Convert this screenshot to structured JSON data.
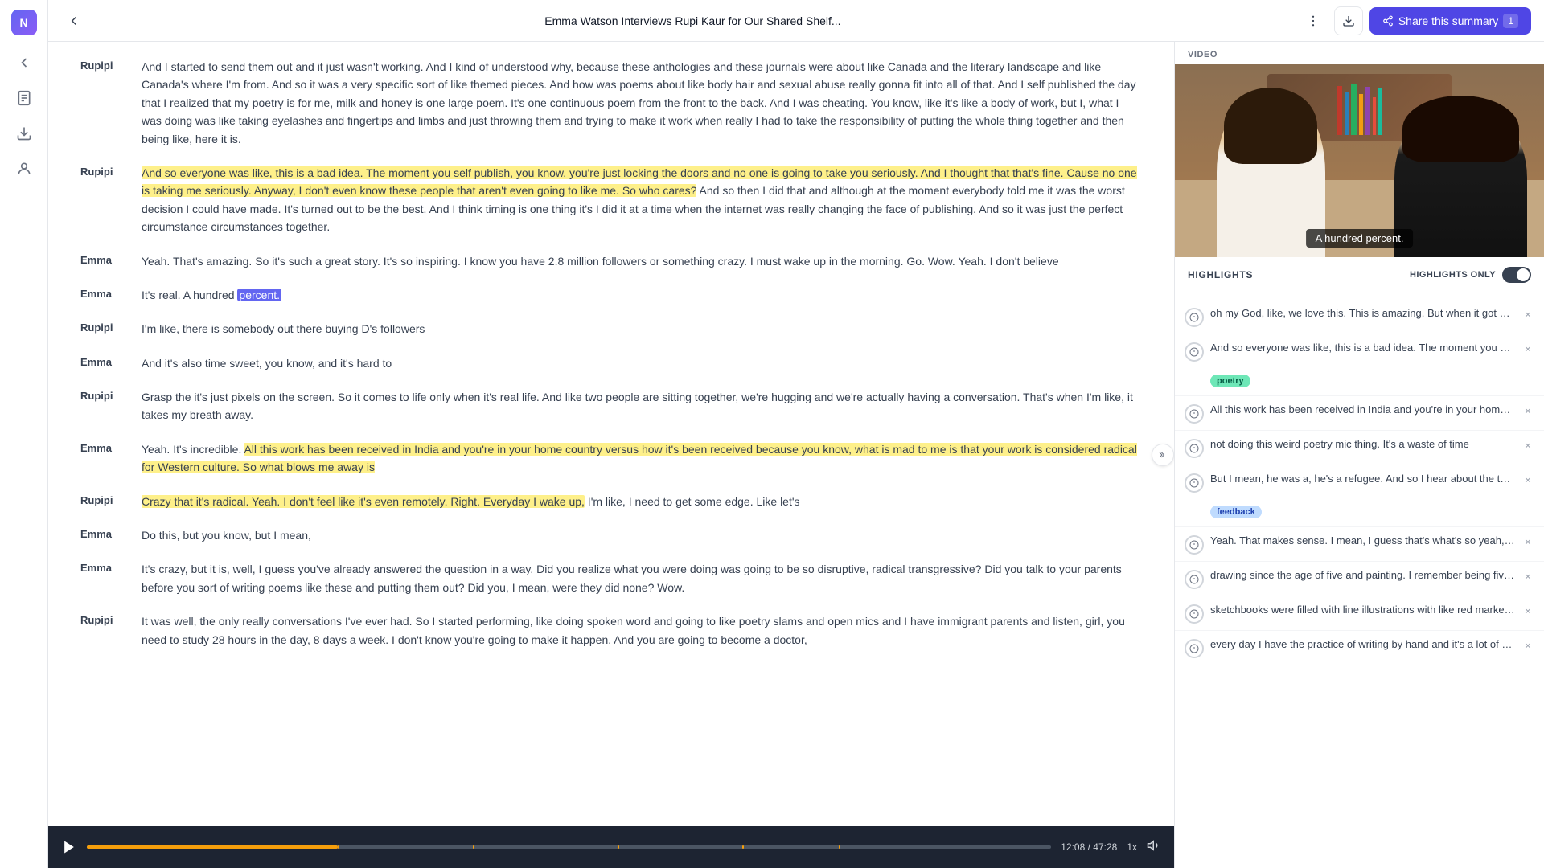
{
  "app": {
    "logo_text": "N",
    "title": "Emma Watson Interviews Rupi Kaur for Our Shared Shelf...",
    "share_button_label": "Share this summary",
    "share_count": "1"
  },
  "sidebar": {
    "icons": [
      "back",
      "document",
      "download",
      "user"
    ]
  },
  "video": {
    "label": "VIDEO",
    "caption": "A hundred percent."
  },
  "highlights": {
    "title": "HIGHLIGHTS",
    "only_label": "HIGHLIGHTS ONLY",
    "items": [
      {
        "text": "oh my God, like, we love this. This is amazing. But when it got out of those circle",
        "tag": null
      },
      {
        "text": "And so everyone was like, this is a bad idea. The moment you self publish, you kn",
        "tag": "poetry"
      },
      {
        "text": "All this work has been received in India and you're in your home country versus I",
        "tag": null
      },
      {
        "text": "not doing this weird poetry mic thing. It's a waste of time",
        "tag": null
      },
      {
        "text": "But I mean, he was a, he's a refugee. And so I hear about the things that he went",
        "tag": "feedback"
      },
      {
        "text": "Yeah. That makes sense. I mean, I guess that's what's so yeah, his existence, his s",
        "tag": null
      },
      {
        "text": "drawing since the age of five and painting. I remember being five years old, we li",
        "tag": null
      },
      {
        "text": "sketchbooks were filled with line illustrations with like red marker. And thank Gc",
        "tag": null
      },
      {
        "text": "every day I have the practice of writing by hand and it's a lot of free writing. Ther",
        "tag": null
      }
    ]
  },
  "player": {
    "current_time": "12:08",
    "total_time": "47:28",
    "speed": "1x",
    "progress_percent": 26,
    "marker_positions": [
      15,
      26,
      40,
      55,
      68,
      78
    ]
  },
  "transcript": [
    {
      "speaker": "Rupipi",
      "text": "And I started to send them out and it just wasn't working. And I kind of understood why, because these anthologies and these journals were about like Canada and the literary landscape and like Canada's where I'm from. And so it was a very specific sort of like themed pieces. And how was poems about like body hair and sexual abuse really gonna fit into all of that. And I self published the day that I realized that my poetry is for me, milk and honey is one large poem. It's one continuous poem from the front to the back. And I was cheating. You know, like it's like a body of work, but I, what I was doing was like taking eyelashes and fingertips and limbs and just throwing them and trying to make it work when really I had to take the responsibility of putting the whole thing together and then being like, here it is.",
      "highlight": false,
      "highlighted_ranges": []
    },
    {
      "speaker": "Rupipi",
      "text": "And so everyone was like, this is a bad idea. The moment you self publish, you know, you're just locking the doors and no one is going to take you seriously. And I thought that that's fine. Cause no one is taking me seriously. Anyway, I don't even know these people that aren't even going to like me. So who cares? And so then I did that and although at the moment everybody told me it was the worst decision I could have made. It's turned out to be the best. And I think timing is one thing it's I did it at a time when the internet was really changing the face of publishing. And so it was just the perfect circumstance circumstances together.",
      "highlight": true,
      "highlighted_ranges": [
        [
          0,
          640
        ]
      ]
    },
    {
      "speaker": "Emma",
      "text": "Yeah. That's amazing. So it's such a great story. It's so inspiring. I know you have 2.8 million followers or something crazy. I must wake up in the morning. Go. Wow. Yeah. I don't believe",
      "highlight": false,
      "highlighted_ranges": []
    },
    {
      "speaker": "Emma",
      "text": "It's real. A hundred percent.",
      "highlight": false,
      "highlighted_ranges": [],
      "word_highlight": "percent."
    },
    {
      "speaker": "Rupipi",
      "text": "I'm like, there is somebody out there buying D's followers",
      "highlight": false
    },
    {
      "speaker": "Emma",
      "text": "And it's also time sweet, you know, and it's hard to",
      "highlight": false
    },
    {
      "speaker": "Rupipi",
      "text": "Grasp the it's just pixels on the screen. So it comes to life only when it's real life. And like two people are sitting together, we're hugging and we're actually having a conversation. That's when I'm like, it takes my breath away.",
      "highlight": false
    },
    {
      "speaker": "Emma",
      "text": "Yeah. It's incredible. All this work has been received in India and you're in your home country versus how it's been received because you know, what is mad to me is that your work is considered radical for Western culture. So what blows me away is",
      "highlight": true,
      "partial_highlight_start": "All this work has been received in India"
    },
    {
      "speaker": "Rupipi",
      "text": "Crazy that it's radical. Yeah. I don't feel like it's even remotely. Right. Everyday I wake up, I'm like, I need to get some edge. Like let's",
      "highlight": true,
      "partial_end": "Crazy that it's radical. Yeah. I don't feel like it's even remotely. Right. Everyday I wake up,"
    },
    {
      "speaker": "Emma",
      "text": "Do this, but you know, but I mean,",
      "highlight": false
    },
    {
      "speaker": "Emma",
      "text": "It's crazy, but it is, well, I guess you've already answered the question in a way. Did you realize what you were doing was going to be so disruptive, radical transgressive? Did you talk to your parents before you sort of writing poems like these and putting them out? Did you, I mean, were they did none? Wow.",
      "highlight": false
    },
    {
      "speaker": "Rupipi",
      "text": "It was well, the only really conversations I've ever had. So I started performing, like doing spoken word and going to like poetry slams and open mics and I have immigrant parents and listen, girl, you need to study 28 hours in the day, 8 days a week. I don't know you're going to make it happen. And you are going to become a doctor,",
      "highlight": false
    }
  ]
}
